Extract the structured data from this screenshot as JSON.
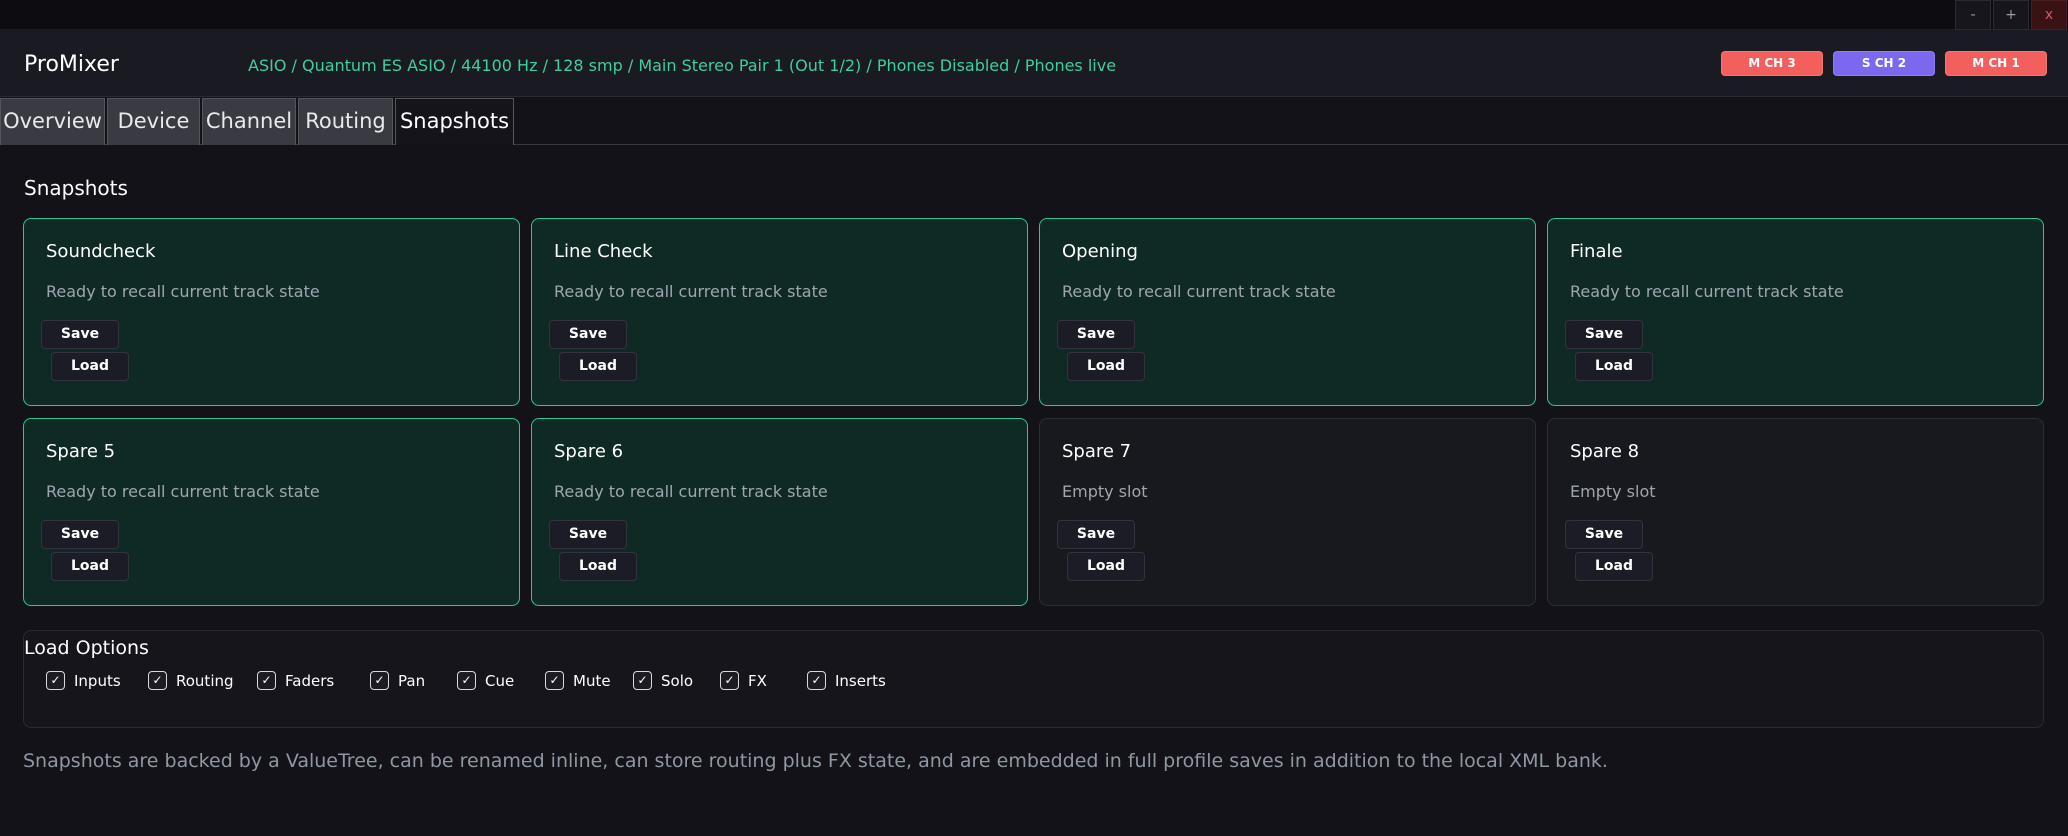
{
  "window": {
    "minimize": "-",
    "maximize": "+",
    "close": "x"
  },
  "header": {
    "title": "ProMixer",
    "status": "ASIO / Quantum ES ASIO / 44100 Hz / 128 smp / Main Stereo Pair 1 (Out 1/2) / Phones Disabled / Phones live",
    "channel_buttons": [
      {
        "label": "M CH 3",
        "color": "#f25f5c"
      },
      {
        "label": "S CH 2",
        "color": "#7b68ee"
      },
      {
        "label": "M CH 1",
        "color": "#f25f5c"
      }
    ]
  },
  "tabs": [
    {
      "label": "Overview",
      "active": false
    },
    {
      "label": "Device",
      "active": false
    },
    {
      "label": "Channel",
      "active": false
    },
    {
      "label": "Routing",
      "active": false
    },
    {
      "label": "Snapshots",
      "active": true
    }
  ],
  "snapshots": {
    "title": "Snapshots",
    "save_label": "Save",
    "load_label": "Load",
    "slots": [
      {
        "name": "Soundcheck",
        "status": "Ready to recall current track state",
        "filled": true
      },
      {
        "name": "Line Check",
        "status": "Ready to recall current track state",
        "filled": true
      },
      {
        "name": "Opening",
        "status": "Ready to recall current track state",
        "filled": true
      },
      {
        "name": "Finale",
        "status": "Ready to recall current track state",
        "filled": true
      },
      {
        "name": "Spare 5",
        "status": "Ready to recall current track state",
        "filled": true
      },
      {
        "name": "Spare 6",
        "status": "Ready to recall current track state",
        "filled": true
      },
      {
        "name": "Spare 7",
        "status": "Empty slot",
        "filled": false
      },
      {
        "name": "Spare 8",
        "status": "Empty slot",
        "filled": false
      }
    ]
  },
  "load_options": {
    "title": "Load Options",
    "items": [
      {
        "label": "Inputs",
        "checked": true
      },
      {
        "label": "Routing",
        "checked": true
      },
      {
        "label": "Faders",
        "checked": true
      },
      {
        "label": "Pan",
        "checked": true
      },
      {
        "label": "Cue",
        "checked": true
      },
      {
        "label": "Mute",
        "checked": true
      },
      {
        "label": "Solo",
        "checked": true
      },
      {
        "label": "FX",
        "checked": true
      },
      {
        "label": "Inserts",
        "checked": true
      }
    ]
  },
  "footnote": "Snapshots are backed by a ValueTree, can be renamed inline, can store routing plus FX state, and are embedded in full profile saves in addition to the local XML bank.",
  "colors": {
    "accent_green": "#2ec78e",
    "status_green": "#3ecf9a",
    "filled_card_bg": "#0f2a25"
  }
}
